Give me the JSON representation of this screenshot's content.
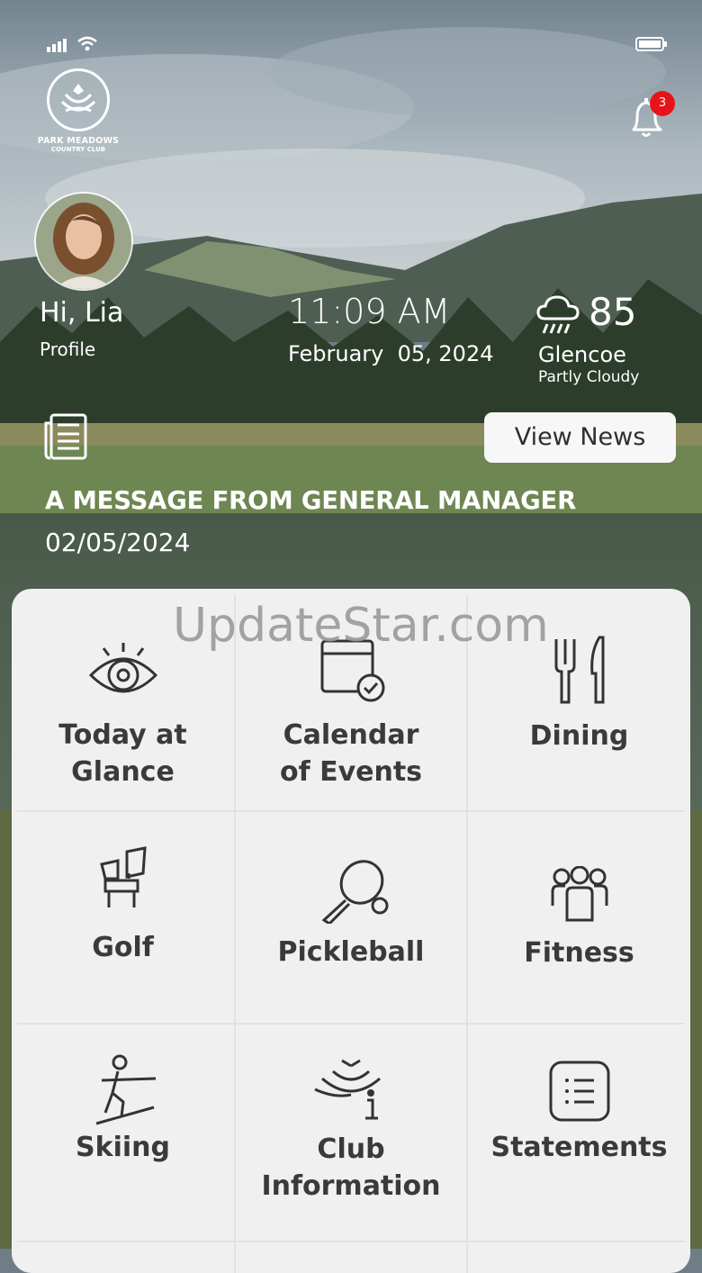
{
  "status_bar": {
    "signal_icon": "cellular-signal-icon",
    "wifi_icon": "wifi-icon",
    "battery_icon": "battery-icon"
  },
  "club": {
    "name_line1": "PARK MEADOWS",
    "name_line2": "COUNTRY CLUB"
  },
  "notifications": {
    "count": "3"
  },
  "user": {
    "greeting": "Hi, Lia",
    "profile_label": "Profile"
  },
  "clock": {
    "time": "11:09 AM",
    "date": "February  05, 2024"
  },
  "weather": {
    "temperature": "85",
    "location": "Glencoe",
    "condition": "Partly Cloudy"
  },
  "news": {
    "button_label": "View News",
    "title": "A MESSAGE FROM GENERAL MANAGER",
    "date": "02/05/2024"
  },
  "watermark": "UpdateStar.com",
  "tiles": [
    {
      "line1": "Today at",
      "line2": "Glance",
      "icon": "eye-icon"
    },
    {
      "line1": "Calendar",
      "line2": "of Events",
      "icon": "calendar-check-icon"
    },
    {
      "line1": "Dining",
      "line2": "",
      "icon": "fork-knife-icon"
    },
    {
      "line1": "Golf",
      "line2": "",
      "icon": "golf-bag-icon"
    },
    {
      "line1": "Pickleball",
      "line2": "",
      "icon": "pickleball-paddle-icon"
    },
    {
      "line1": "Fitness",
      "line2": "",
      "icon": "group-people-icon"
    },
    {
      "line1": "Skiing",
      "line2": "",
      "icon": "skier-icon"
    },
    {
      "line1": "Club",
      "line2": "Information",
      "icon": "club-info-icon"
    },
    {
      "line1": "Statements",
      "line2": "",
      "icon": "statement-list-icon"
    }
  ],
  "colors": {
    "badge": "#e8131a",
    "panel": "#f0f0f0",
    "icon_stroke": "#333333"
  }
}
